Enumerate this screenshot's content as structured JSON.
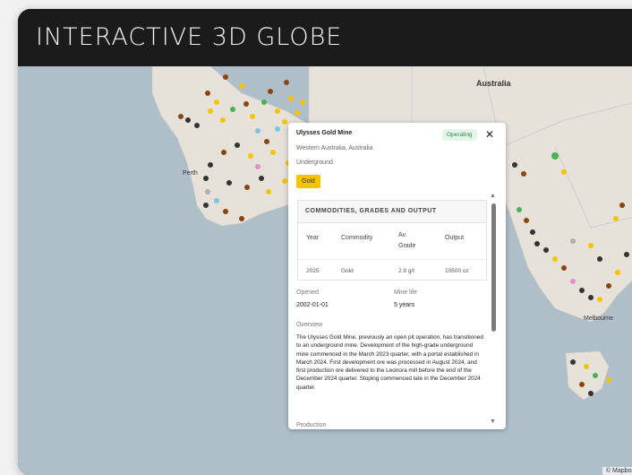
{
  "header": {
    "title": "INTERACTIVE 3D GLOBE"
  },
  "map": {
    "labels": {
      "australia": "Australia",
      "perth": "Perth",
      "melbourne": "Melbourne"
    },
    "attribution": "© Mapbox ©"
  },
  "popup": {
    "name": "Ulysses Gold Mine",
    "location": "Western Australia, Australia",
    "mining_method": "Underground",
    "status": "Operating",
    "close_symbol": "✕",
    "commodity_badge": "Gold",
    "section_title": "COMMODITIES, GRADES AND OUTPUT",
    "table": {
      "headers": [
        "Year",
        "Commodity",
        "Av. Grade",
        "Output"
      ],
      "rows": [
        [
          "2025",
          "Gold",
          "2.9 g/t",
          "10500 oz"
        ]
      ]
    },
    "opened_label": "Opened",
    "opened_value": "2002-01-01",
    "mine_life_label": "Mine life",
    "mine_life_value": "5 years",
    "overview_label": "Overview",
    "overview_text": "The Ulysses Gold Mine, previously an open pit operation, has transitioned to an underground mine. Development of the high-grade underground mine commenced in the March 2023 quarter, with a portal established in March 2024. First development ore was processed in August 2024, and first production ore delivered to the Leonora mill before the end of the December 2024 quarter. Stoping commenced late in the December 2024 quarter.",
    "production_label": "Production"
  },
  "colors": {
    "gold": "#f4c400",
    "copper": "#8b4513",
    "lithium": "#7ec8e3",
    "nickel": "#4caf50",
    "coal": "#333333",
    "iron": "#b0b0b0",
    "rare_earths": "#e98bcf",
    "ocean": "#aebfca",
    "land": "#e8e4dc"
  }
}
